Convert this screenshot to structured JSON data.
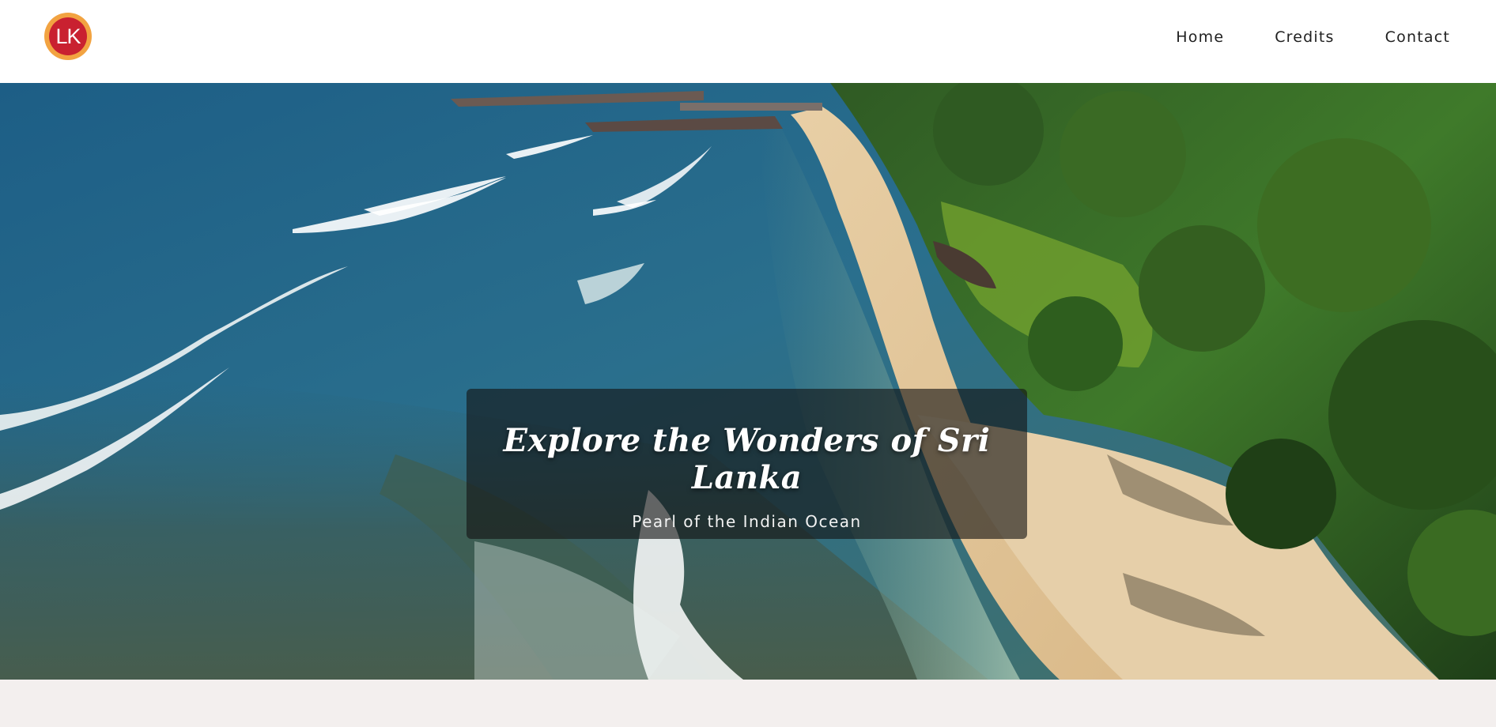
{
  "brand": {
    "logo_text": "LK",
    "logo_ring_color": "#f2a341",
    "logo_fill_color": "#c92130"
  },
  "nav": {
    "items": [
      "Home",
      "Credits",
      "Contact"
    ]
  },
  "hero": {
    "title": "Explore the Wonders of Sri Lanka",
    "subtitle": "Pearl of the Indian Ocean",
    "image_icon": "aerial-beach-photo"
  },
  "colors": {
    "header_bg": "#ffffff",
    "page_bg": "#f3efee",
    "overlay": "rgba(20,20,20,0.62)"
  }
}
